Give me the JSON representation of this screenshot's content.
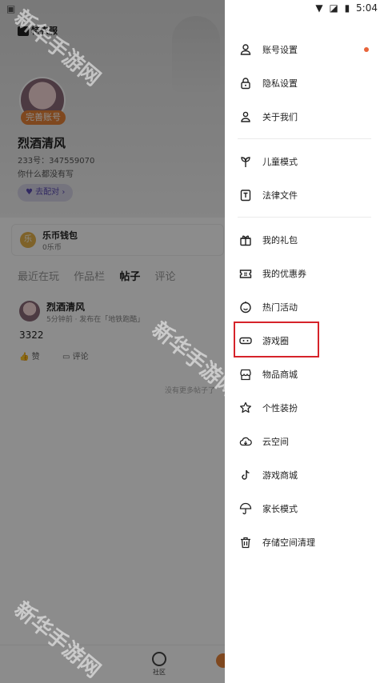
{
  "status_bar": {
    "time": "5:04"
  },
  "background": {
    "logo": "特衣服",
    "avatar_badge": "完善账号",
    "username": "烈酒清风",
    "user_id": "233号：347559070",
    "bio": "你什么都没有写",
    "pair_button": "去配对",
    "wallet": {
      "coin_label": "乐",
      "title": "乐币钱包",
      "balance": "0乐币"
    },
    "tabs": [
      {
        "label": "最近在玩"
      },
      {
        "label": "作品栏"
      },
      {
        "label": "帖子",
        "active": true
      },
      {
        "label": "评论"
      }
    ],
    "post": {
      "user": "烈酒清风",
      "meta": "5分钟前 · 发布在「地铁跑酷」",
      "text": "3322",
      "like_label": "赞",
      "comment_label": "评论"
    },
    "no_more": "没有更多帖子了",
    "bottom_nav": {
      "community_label": "社区"
    }
  },
  "watermark": "新华手游网",
  "drawer": {
    "groups": [
      [
        {
          "label": "账号设置",
          "icon": "user-icon",
          "dot": true
        },
        {
          "label": "隐私设置",
          "icon": "lock-icon"
        },
        {
          "label": "关于我们",
          "icon": "about-icon"
        }
      ],
      [
        {
          "label": "儿童模式",
          "icon": "sprout-icon"
        },
        {
          "label": "法律文件",
          "icon": "document-icon"
        }
      ],
      [
        {
          "label": "我的礼包",
          "icon": "gift-icon"
        },
        {
          "label": "我的优惠券",
          "icon": "coupon-icon"
        },
        {
          "label": "热门活动",
          "icon": "smile-icon"
        },
        {
          "label": "游戏圈",
          "icon": "gamepad-icon",
          "highlighted": true
        },
        {
          "label": "物品商城",
          "icon": "store-icon"
        },
        {
          "label": "个性装扮",
          "icon": "star-badge-icon"
        },
        {
          "label": "云空间",
          "icon": "cloud-icon"
        },
        {
          "label": "游戏商城",
          "icon": "tiktok-icon"
        },
        {
          "label": "家长模式",
          "icon": "umbrella-icon"
        },
        {
          "label": "存储空间清理",
          "icon": "trash-icon"
        }
      ]
    ],
    "highlight_color": "#d6232a",
    "dot_color": "#e8643a"
  }
}
